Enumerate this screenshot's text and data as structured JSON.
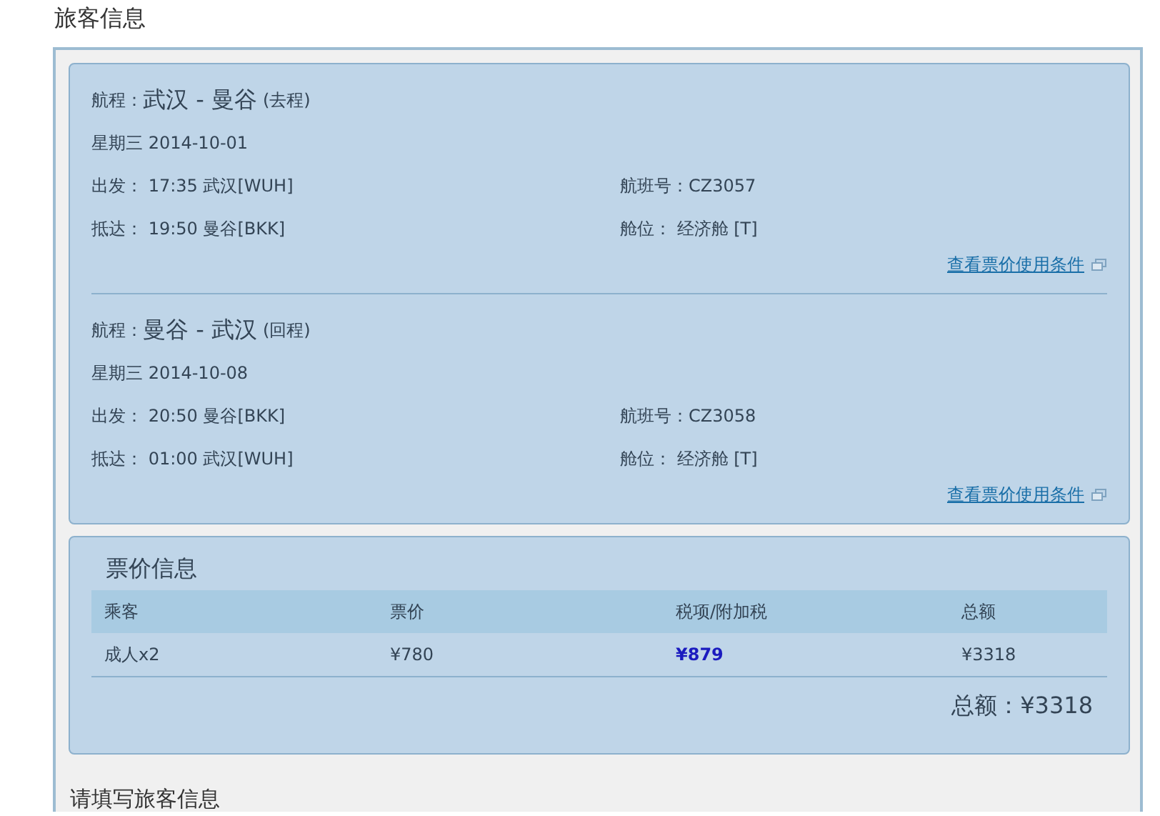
{
  "title": "旅客信息",
  "segments": [
    {
      "route_label": "航程：",
      "route": "武汉 - 曼谷",
      "direction": "(去程)",
      "date": "星期三 2014-10-01",
      "depart": "出发： 17:35 武汉[WUH]",
      "flight": "航班号：CZ3057",
      "arrive": "抵达： 19:50 曼谷[BKK]",
      "cabin": "舱位： 经济舱 [T]",
      "link": "查看票价使用条件"
    },
    {
      "route_label": "航程：",
      "route": "曼谷 - 武汉",
      "direction": "(回程)",
      "date": "星期三 2014-10-08",
      "depart": "出发： 20:50 曼谷[BKK]",
      "flight": "航班号：CZ3058",
      "arrive": "抵达： 01:00 武汉[WUH]",
      "cabin": "舱位： 经济舱 [T]",
      "link": "查看票价使用条件"
    }
  ],
  "fare": {
    "title": "票价信息",
    "columns": [
      "乘客",
      "票价",
      "税项/附加税",
      "总额"
    ],
    "rows": [
      [
        {
          "text": "成人x2",
          "kind": "plain"
        },
        {
          "text": "¥780",
          "kind": "plain"
        },
        {
          "text": "¥879",
          "kind": "link"
        },
        {
          "text": "¥3318",
          "kind": "plain"
        }
      ]
    ],
    "total": "总额：¥3318"
  },
  "next_section": "请填写旅客信息"
}
